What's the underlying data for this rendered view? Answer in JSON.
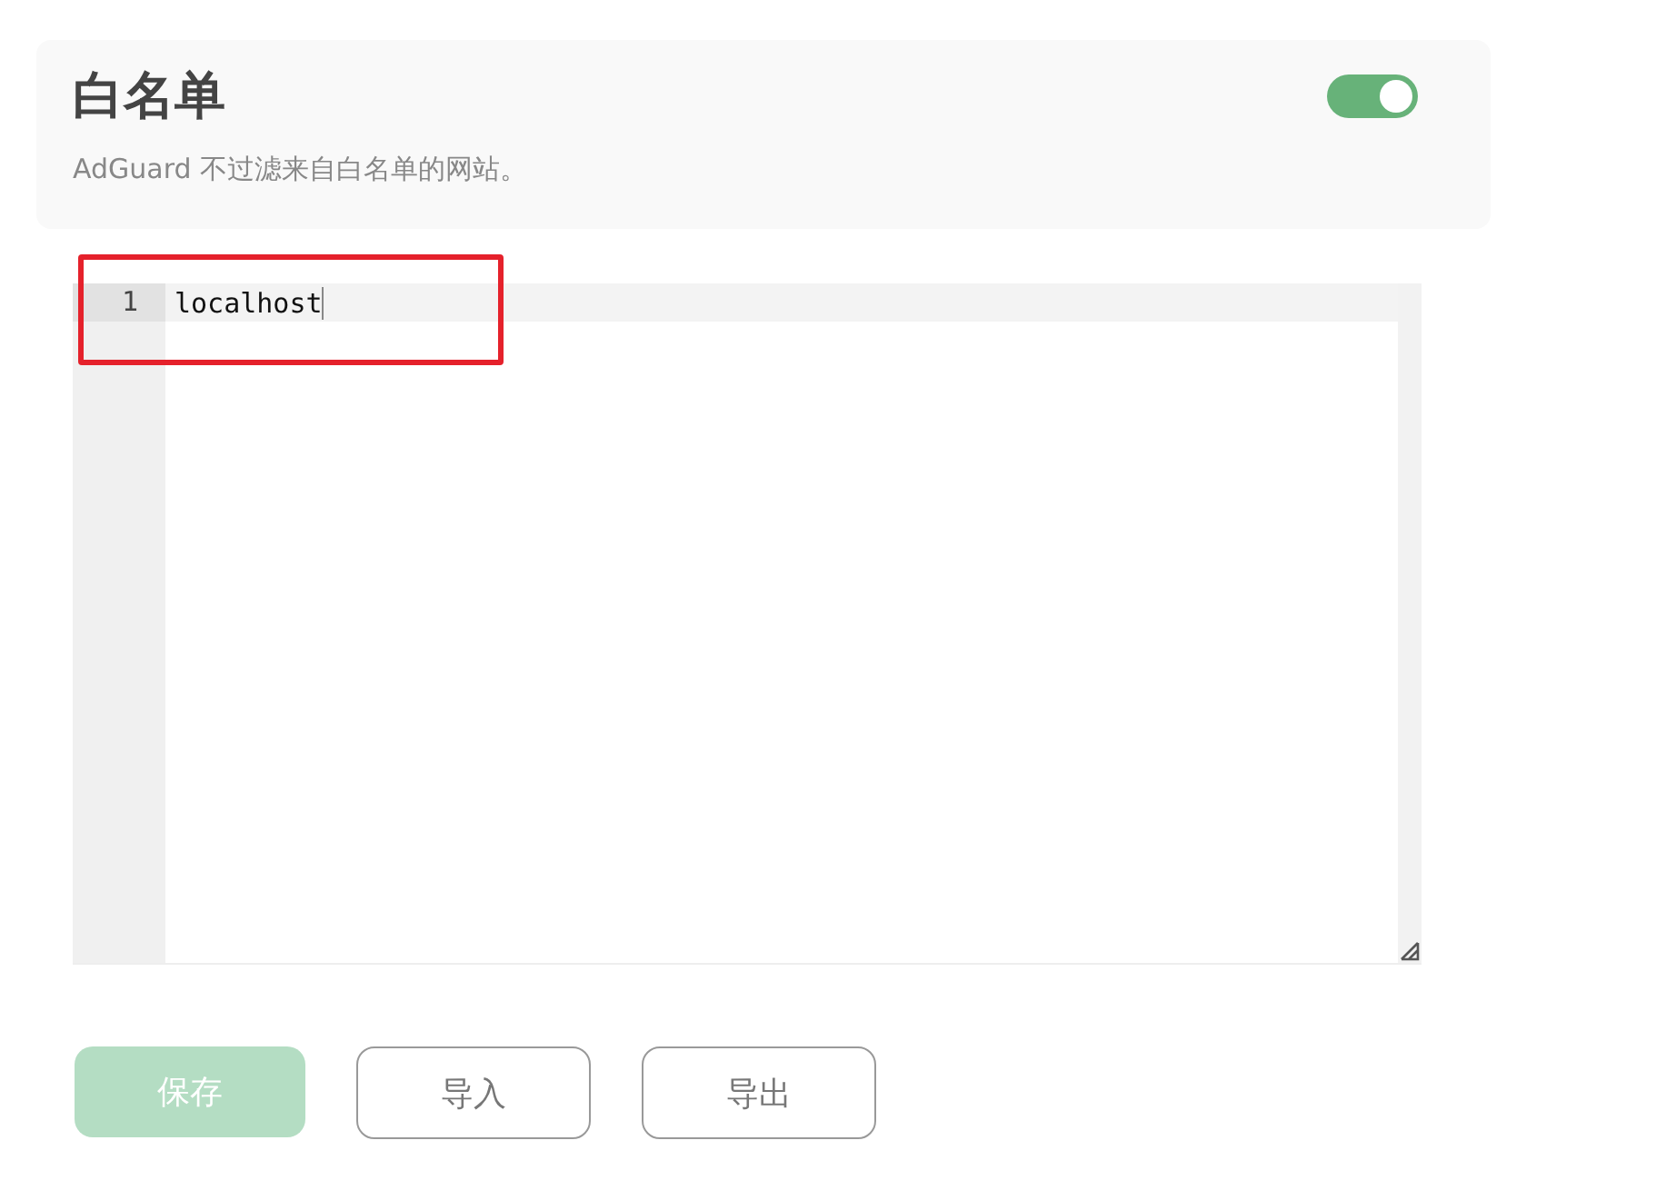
{
  "header": {
    "title": "白名单",
    "description": "AdGuard 不过滤来自白名单的网站。",
    "toggle": {
      "on": true
    }
  },
  "editor": {
    "lines": [
      {
        "number": "1",
        "text": "localhost",
        "active": true
      }
    ]
  },
  "buttons": [
    {
      "label": "保存",
      "kind": "primary",
      "disabled": true
    },
    {
      "label": "导入",
      "kind": "outline",
      "disabled": false
    },
    {
      "label": "导出",
      "kind": "outline",
      "disabled": false
    }
  ]
}
